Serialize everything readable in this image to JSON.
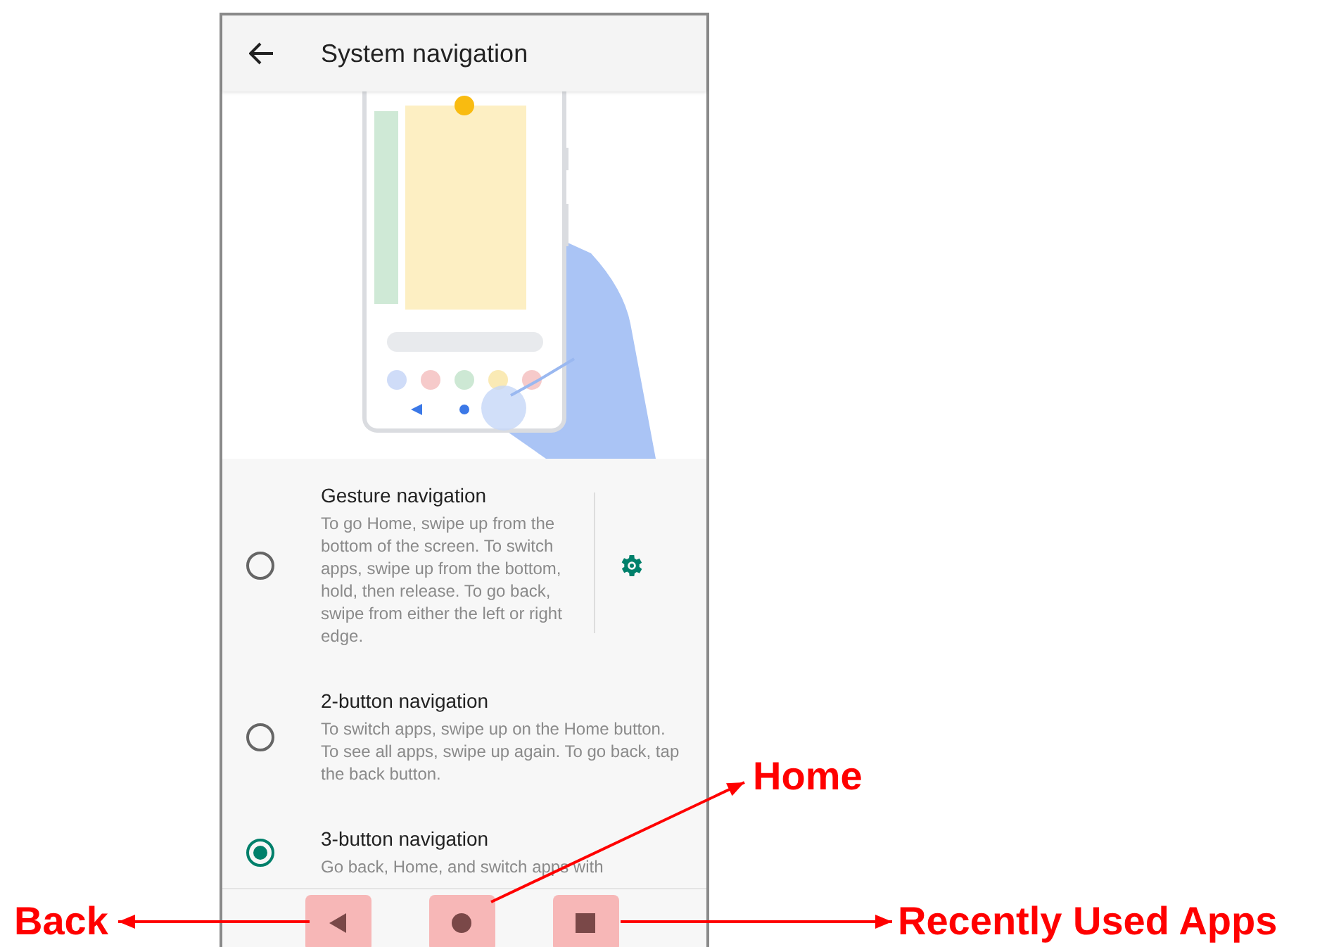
{
  "header": {
    "title": "System navigation"
  },
  "options": [
    {
      "title": "Gesture navigation",
      "description": "To go Home, swipe up from the bottom of the screen. To switch apps, swipe up from the bottom, hold, then release. To go back, swipe from either the left or right edge.",
      "selected": false,
      "settings": true
    },
    {
      "title": "2-button navigation",
      "description": "To switch apps, swipe up on the Home button. To see all apps, swipe up again. To go back, tap the back button.",
      "selected": false,
      "settings": false
    },
    {
      "title": "3-button navigation",
      "description": "Go back, Home, and switch apps with",
      "selected": true,
      "settings": false
    }
  ],
  "nav_bar": {
    "buttons": [
      {
        "kind": "back",
        "highlighted": true,
        "annotation": "Back"
      },
      {
        "kind": "home",
        "highlighted": true,
        "annotation": "Home"
      },
      {
        "kind": "recents",
        "highlighted": true,
        "annotation": "Recently Used Apps"
      }
    ]
  }
}
